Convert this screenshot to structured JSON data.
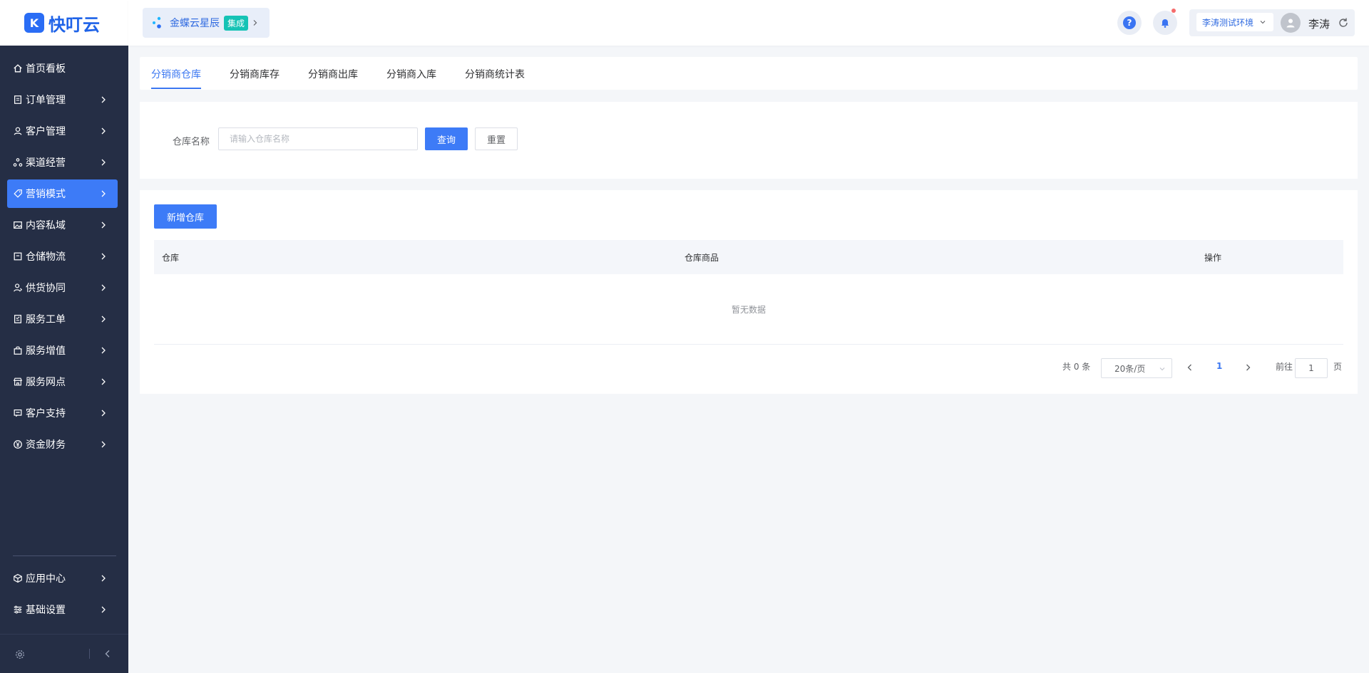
{
  "brand": {
    "logo_letter": "K",
    "name": "快叮云"
  },
  "integration": {
    "name": "金蝶云星辰",
    "tag": "集成"
  },
  "header": {
    "help_glyph": "?",
    "environment": "李涛测试环境",
    "user_name": "李涛"
  },
  "sidebar": {
    "items": [
      {
        "label": "首页看板",
        "icon": "home-icon"
      },
      {
        "label": "订单管理",
        "icon": "order-icon"
      },
      {
        "label": "客户管理",
        "icon": "user-icon"
      },
      {
        "label": "渠道经营",
        "icon": "channel-icon"
      },
      {
        "label": "营销模式",
        "icon": "tag-icon",
        "active": true
      },
      {
        "label": "内容私域",
        "icon": "image-icon"
      },
      {
        "label": "仓储物流",
        "icon": "box-icon"
      },
      {
        "label": "供货协同",
        "icon": "supply-icon"
      },
      {
        "label": "服务工单",
        "icon": "ticket-icon"
      },
      {
        "label": "服务增值",
        "icon": "bag-icon"
      },
      {
        "label": "服务网点",
        "icon": "store-icon"
      },
      {
        "label": "客户支持",
        "icon": "support-icon"
      },
      {
        "label": "资金财务",
        "icon": "yen-icon"
      }
    ],
    "bottom_items": [
      {
        "label": "应用中心",
        "icon": "cube-icon"
      },
      {
        "label": "基础设置",
        "icon": "settings-icon"
      }
    ]
  },
  "tabs": [
    {
      "label": "分销商仓库",
      "active": true
    },
    {
      "label": "分销商库存"
    },
    {
      "label": "分销商出库"
    },
    {
      "label": "分销商入库"
    },
    {
      "label": "分销商统计表"
    }
  ],
  "search": {
    "label": "仓库名称",
    "placeholder": "请输入仓库名称",
    "value": "",
    "query_label": "查询",
    "reset_label": "重置"
  },
  "table": {
    "add_label": "新增仓库",
    "columns": [
      "仓库",
      "仓库商品",
      "操作"
    ],
    "empty_text": "暂无数据"
  },
  "pagination": {
    "total_text": "共 0 条",
    "page_size": "20条/页",
    "current_page": "1",
    "goto_label": "前往",
    "goto_value": "1",
    "page_unit": "页"
  },
  "colors": {
    "sidebar_bg": "#252e45",
    "accent": "#3d7bf7",
    "page_bg": "#f4f6f9"
  }
}
